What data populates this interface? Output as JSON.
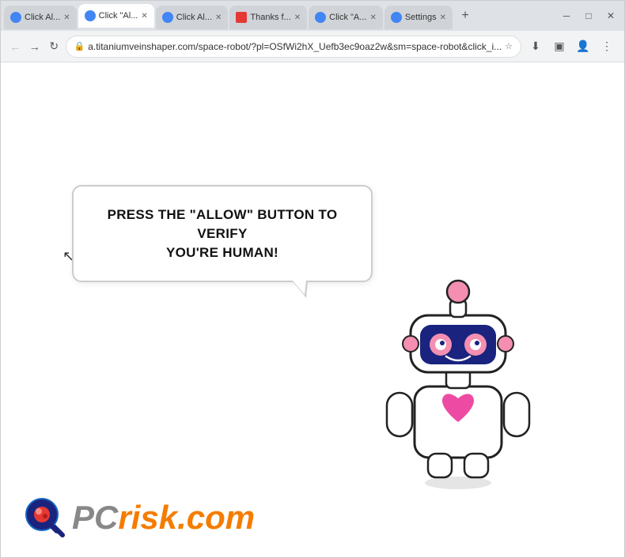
{
  "browser": {
    "tabs": [
      {
        "id": 1,
        "label": "Click Al...",
        "active": false,
        "favicon_color": "#4285f4"
      },
      {
        "id": 2,
        "label": "Click \"Al...",
        "active": true,
        "favicon_color": "#4285f4"
      },
      {
        "id": 3,
        "label": "Click Al...",
        "active": false,
        "favicon_color": "#4285f4"
      },
      {
        "id": 4,
        "label": "Thanks f...",
        "active": false,
        "favicon_color": "#e53935"
      },
      {
        "id": 5,
        "label": "Click \"A...",
        "active": false,
        "favicon_color": "#4285f4"
      },
      {
        "id": 6,
        "label": "Settings",
        "active": false,
        "favicon_color": "#4285f4"
      }
    ],
    "address": "a.titaniumveinshaper.com/space-robot/?pl=OSfWi2hX_Uefb3ec9oaz2w&sm=space-robot&click_i..."
  },
  "page": {
    "speech_bubble_line1": "PRESS THE \"ALLOW\" BUTTON TO VERIFY",
    "speech_bubble_line2": "YOU'RE HUMAN!"
  },
  "logo": {
    "pc": "PC",
    "risk": "risk.com"
  }
}
